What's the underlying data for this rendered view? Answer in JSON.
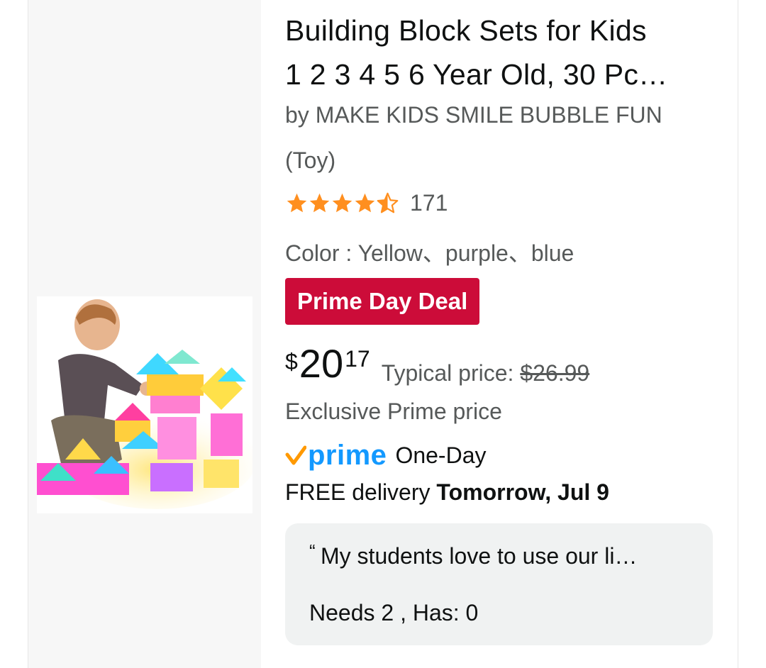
{
  "product": {
    "title_line1": "Building Block Sets for Kids",
    "title_line2": "1 2 3 4 5 6 Year Old, 30 Pc…",
    "byline": "by MAKE KIDS SMILE BUBBLE FUN",
    "binding": "(Toy)",
    "rating": 4.5,
    "rating_count": "171",
    "color_line": "Color : Yellow、purple、blue",
    "image_icon": "child-building-blocks-photo"
  },
  "deal": {
    "badge": "Prime Day Deal",
    "badge_color": "#cc0c39"
  },
  "price": {
    "symbol": "$",
    "whole": "20",
    "fraction": "17",
    "typical_label": "Typical price: ",
    "typical_value": "$26.99",
    "exclusive": "Exclusive Prime price"
  },
  "shipping": {
    "prime_word": "prime",
    "prime_color": "#1399ff",
    "check_color": "#ff9900",
    "one_day": "One-Day",
    "delivery_prefix": "FREE delivery ",
    "delivery_date": "Tomorrow, Jul 9"
  },
  "review": {
    "quote_mark": "“",
    "snippet": "My students love to use our li…",
    "status": "Needs 2 , Has: 0"
  },
  "colors": {
    "star": "#ff8f1f",
    "secondary_text": "#565959",
    "review_bg": "#f0f2f2"
  }
}
